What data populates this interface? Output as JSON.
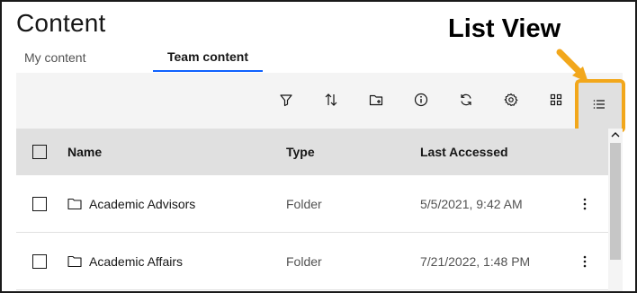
{
  "page": {
    "title": "Content"
  },
  "annotation": {
    "label": "List View",
    "color": "#f2a71b"
  },
  "tabs": [
    {
      "label": "My content",
      "selected": false
    },
    {
      "label": "Team content",
      "selected": true
    }
  ],
  "toolbar": {
    "icons": [
      "filter-icon",
      "sort-icon",
      "new-folder-icon",
      "info-icon",
      "refresh-icon",
      "settings-icon",
      "grid-view-icon",
      "list-view-icon"
    ],
    "active": "list-view-icon"
  },
  "table": {
    "columns": {
      "name": "Name",
      "type": "Type",
      "last_accessed": "Last Accessed"
    },
    "rows": [
      {
        "name": "Academic Advisors",
        "type": "Folder",
        "last_accessed": "5/5/2021, 9:42 AM"
      },
      {
        "name": "Academic Affairs",
        "type": "Folder",
        "last_accessed": "7/21/2022, 1:48 PM"
      }
    ]
  },
  "colors": {
    "accent": "#0f62fe",
    "toolbar_bg": "#f4f4f4",
    "header_bg": "#e0e0e0"
  }
}
